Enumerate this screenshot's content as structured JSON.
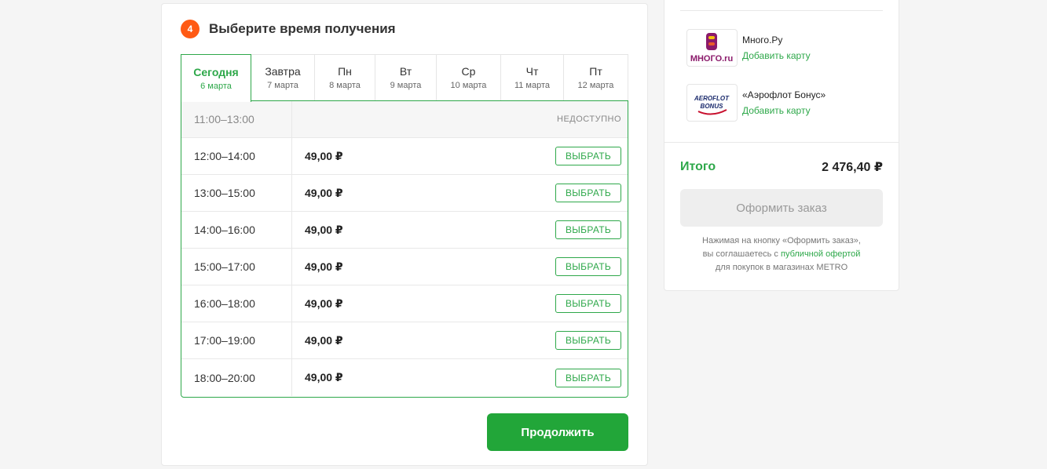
{
  "step": {
    "number": "4",
    "title": "Выберите время получения"
  },
  "tabs": [
    {
      "day": "Сегодня",
      "date": "6 марта",
      "active": true
    },
    {
      "day": "Завтра",
      "date": "7 марта",
      "active": false
    },
    {
      "day": "Пн",
      "date": "8 марта",
      "active": false
    },
    {
      "day": "Вт",
      "date": "9 марта",
      "active": false
    },
    {
      "day": "Ср",
      "date": "10 марта",
      "active": false
    },
    {
      "day": "Чт",
      "date": "11 марта",
      "active": false
    },
    {
      "day": "Пт",
      "date": "12 марта",
      "active": false
    }
  ],
  "slots": [
    {
      "time": "11:00–13:00",
      "available": false,
      "status": "НЕДОСТУПНО"
    },
    {
      "time": "12:00–14:00",
      "available": true,
      "price": "49,00 ₽",
      "button": "ВЫБРАТЬ"
    },
    {
      "time": "13:00–15:00",
      "available": true,
      "price": "49,00 ₽",
      "button": "ВЫБРАТЬ"
    },
    {
      "time": "14:00–16:00",
      "available": true,
      "price": "49,00 ₽",
      "button": "ВЫБРАТЬ"
    },
    {
      "time": "15:00–17:00",
      "available": true,
      "price": "49,00 ₽",
      "button": "ВЫБРАТЬ"
    },
    {
      "time": "16:00–18:00",
      "available": true,
      "price": "49,00 ₽",
      "button": "ВЫБРАТЬ"
    },
    {
      "time": "17:00–19:00",
      "available": true,
      "price": "49,00 ₽",
      "button": "ВЫБРАТЬ"
    },
    {
      "time": "18:00–20:00",
      "available": true,
      "price": "49,00 ₽",
      "button": "ВЫБРАТЬ"
    }
  ],
  "continue_label": "Продолжить",
  "sidebar": {
    "loyalty": [
      {
        "name": "Много.Ру",
        "link": "Добавить карту",
        "logo_text": "МНОГО.ru"
      },
      {
        "name": "«Аэрофлот Бонус»",
        "link": "Добавить карту",
        "logo_text_1": "AEROFLOT",
        "logo_text_2": "BONUS"
      }
    ],
    "total_label": "Итого",
    "total_value": "2 476,40 ₽",
    "order_label": "Оформить заказ",
    "disclaimer_1": "Нажимая на кнопку «Оформить заказ»,",
    "disclaimer_2a": "вы соглашаетесь с ",
    "disclaimer_2b": "публичной офертой",
    "disclaimer_3": "для покупок в магазинах METRO"
  },
  "colors": {
    "accent_green": "#2ea84a",
    "button_green": "#22a639",
    "step_orange": "#ff5a14",
    "mnogo_purple": "#8b1a6b",
    "aeroflot_red": "#c8102e",
    "aeroflot_navy": "#1a2a6c"
  }
}
